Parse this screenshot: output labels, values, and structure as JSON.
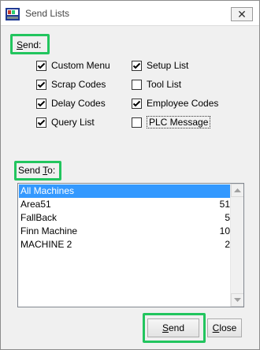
{
  "window": {
    "title": "Send Lists",
    "close_glyph": "✕"
  },
  "send_section": {
    "label_prefix": "",
    "label_underlined": "S",
    "label_rest": "end:",
    "checkboxes": [
      {
        "label": "Custom Menu",
        "checked": true
      },
      {
        "label": "Scrap Codes",
        "checked": true
      },
      {
        "label": "Delay Codes",
        "checked": true
      },
      {
        "label": "Query List",
        "checked": true
      },
      {
        "label": "Setup List",
        "checked": true
      },
      {
        "label": "Tool List",
        "checked": false
      },
      {
        "label": "Employee Codes",
        "checked": true
      },
      {
        "label": "PLC Message",
        "checked": false
      }
    ]
  },
  "send_to_section": {
    "label_prefix": "Send ",
    "label_underlined": "T",
    "label_rest": "o:",
    "machines": [
      {
        "name": "All Machines",
        "count": "",
        "selected": true
      },
      {
        "name": "Area51",
        "count": "51",
        "selected": false
      },
      {
        "name": "FallBack",
        "count": "5",
        "selected": false
      },
      {
        "name": "Finn Machine",
        "count": "10",
        "selected": false
      },
      {
        "name": "MACHINE 2",
        "count": "2",
        "selected": false
      }
    ]
  },
  "buttons": {
    "send_underlined": "S",
    "send_rest": "end",
    "close_underlined": "C",
    "close_rest": "lose"
  },
  "icons": {
    "app": "send-lists-app-icon",
    "close": "close-icon",
    "check": "checkmark-icon",
    "scroll_up": "scroll-up-arrow-icon",
    "scroll_down": "scroll-down-arrow-icon"
  },
  "colors": {
    "highlight": "#22c55e",
    "selection": "#3399ff"
  }
}
